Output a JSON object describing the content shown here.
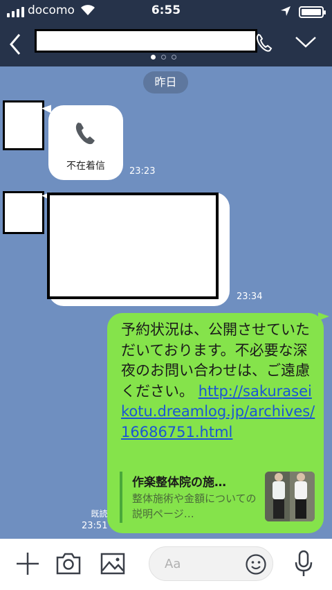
{
  "status": {
    "carrier": "docomo",
    "time": "6:55"
  },
  "chat": {
    "date_label": "昨日",
    "missed_call": {
      "label": "不在着信",
      "time": "23:23"
    },
    "redacted_message_time": "23:34",
    "sent_message": {
      "text": "予約状況は、公開させていただいております。不必要な深夜のお問い合わせは、ご遠慮ください。",
      "url": "http://sakuraseikotu.dreamlog.jp/archives/16686751.html",
      "read_label": "既読",
      "time": "23:51"
    },
    "link_preview": {
      "title": "作楽整体院の施…",
      "description": "整体施術や金額についての説明ページ…"
    }
  },
  "input": {
    "placeholder": "Aa"
  },
  "icons": [
    "back-icon",
    "phone-icon",
    "chevron-down-icon",
    "plus-icon",
    "camera-icon",
    "image-icon",
    "emoji-icon",
    "microphone-icon"
  ],
  "colors": {
    "header": "#26334a",
    "sent_bubble": "#85e34b",
    "link": "#1a54d6"
  }
}
